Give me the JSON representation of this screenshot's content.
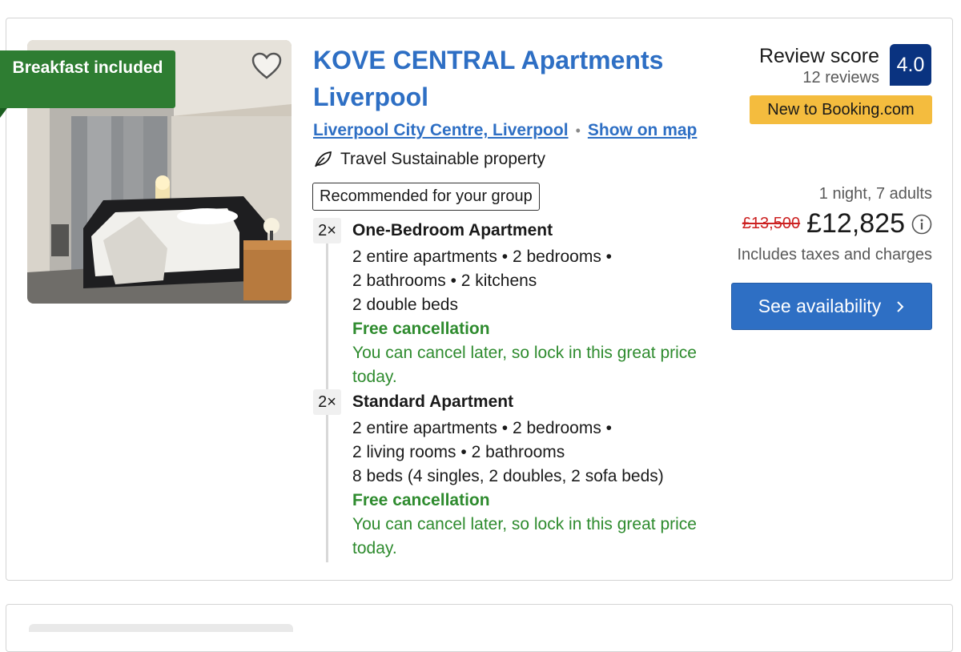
{
  "listing": {
    "badge": "Breakfast included",
    "title": "KOVE CENTRAL Apartments Liverpool",
    "location": "Liverpool City Centre, Liverpool",
    "map_link": "Show on map",
    "sustainable": "Travel Sustainable property",
    "recommended": "Recommended for your group",
    "rooms": [
      {
        "qty": "2×",
        "name": "One-Bedroom Apartment",
        "detail_lines": [
          "2 entire apartments • 2 bedrooms •",
          "2 bathrooms • 2 kitchens",
          "2 double beds"
        ],
        "cancel": "Free cancellation",
        "cancel_note": "You can cancel later, so lock in this great price today."
      },
      {
        "qty": "2×",
        "name": "Standard Apartment",
        "detail_lines": [
          "2 entire apartments • 2 bedrooms •",
          "2 living rooms • 2 bathrooms",
          "8 beds (4 singles, 2 doubles, 2 sofa beds)"
        ],
        "cancel": "Free cancellation",
        "cancel_note": "You can cancel later, so lock in this great price today."
      }
    ],
    "review": {
      "label": "Review score",
      "count": "12 reviews",
      "score": "4.0"
    },
    "new_badge": "New to Booking.com",
    "pricing": {
      "stay": "1 night, 7 adults",
      "old_price": "£13,500",
      "price": "£12,825",
      "taxes": "Includes taxes and charges"
    },
    "cta": "See availability"
  },
  "icons": {
    "favorite": "heart-icon",
    "sustainable": "leaf-icon",
    "info": "info-icon",
    "cta_arrow": "chevron-right-icon"
  },
  "colors": {
    "link": "#2e6fc4",
    "badge_green": "#2e7d32",
    "free_green": "#2e8b2e",
    "score_bg": "#0a3380",
    "new_badge": "#f4bc3e",
    "old_price": "#cc2222"
  }
}
